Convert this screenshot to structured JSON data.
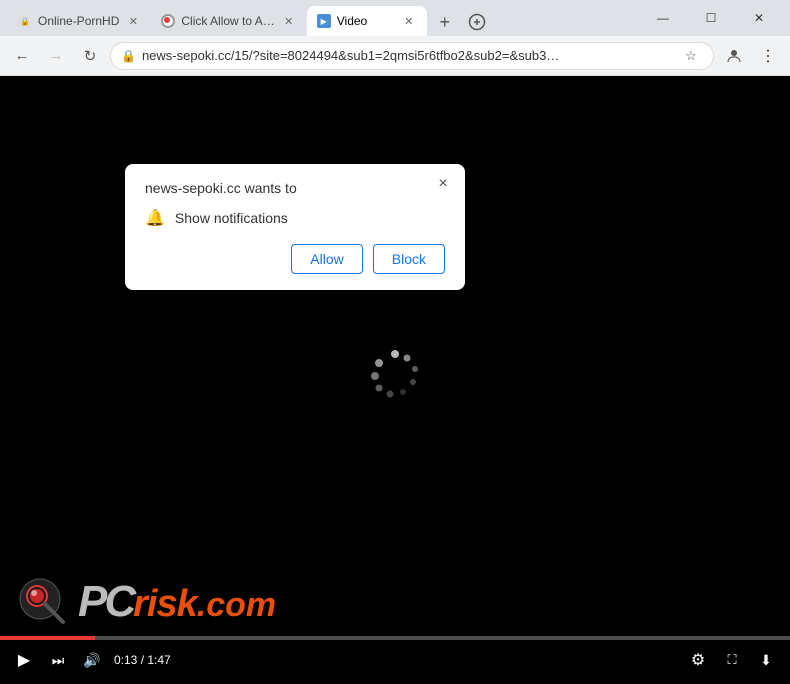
{
  "titlebar": {
    "tabs": [
      {
        "id": "tab1",
        "label": "Online-PornHD",
        "active": false,
        "favicon": "adult"
      },
      {
        "id": "tab2",
        "label": "Click Allow to A…",
        "active": false,
        "favicon": "orange"
      },
      {
        "id": "tab3",
        "label": "Video",
        "active": true,
        "favicon": "video"
      }
    ],
    "new_tab_label": "+",
    "window_controls": {
      "minimize": "—",
      "maximize": "☐",
      "close": "✕"
    }
  },
  "addressbar": {
    "url": "news-sepoki.cc/15/?site=8024494&sub1=2qmsi5r6tfbo2&sub2=&sub3…",
    "back_disabled": false,
    "forward_disabled": false
  },
  "notification_popup": {
    "title": "news-sepoki.cc wants to",
    "close_label": "×",
    "permission": "Show notifications",
    "allow_label": "Allow",
    "block_label": "Block"
  },
  "video_controls": {
    "time_current": "0:13",
    "time_total": "1:47",
    "time_display": "0:13 / 1:47"
  },
  "watermark": {
    "pc_text": "PC",
    "risk_text": "risk",
    "domain": ".com"
  }
}
